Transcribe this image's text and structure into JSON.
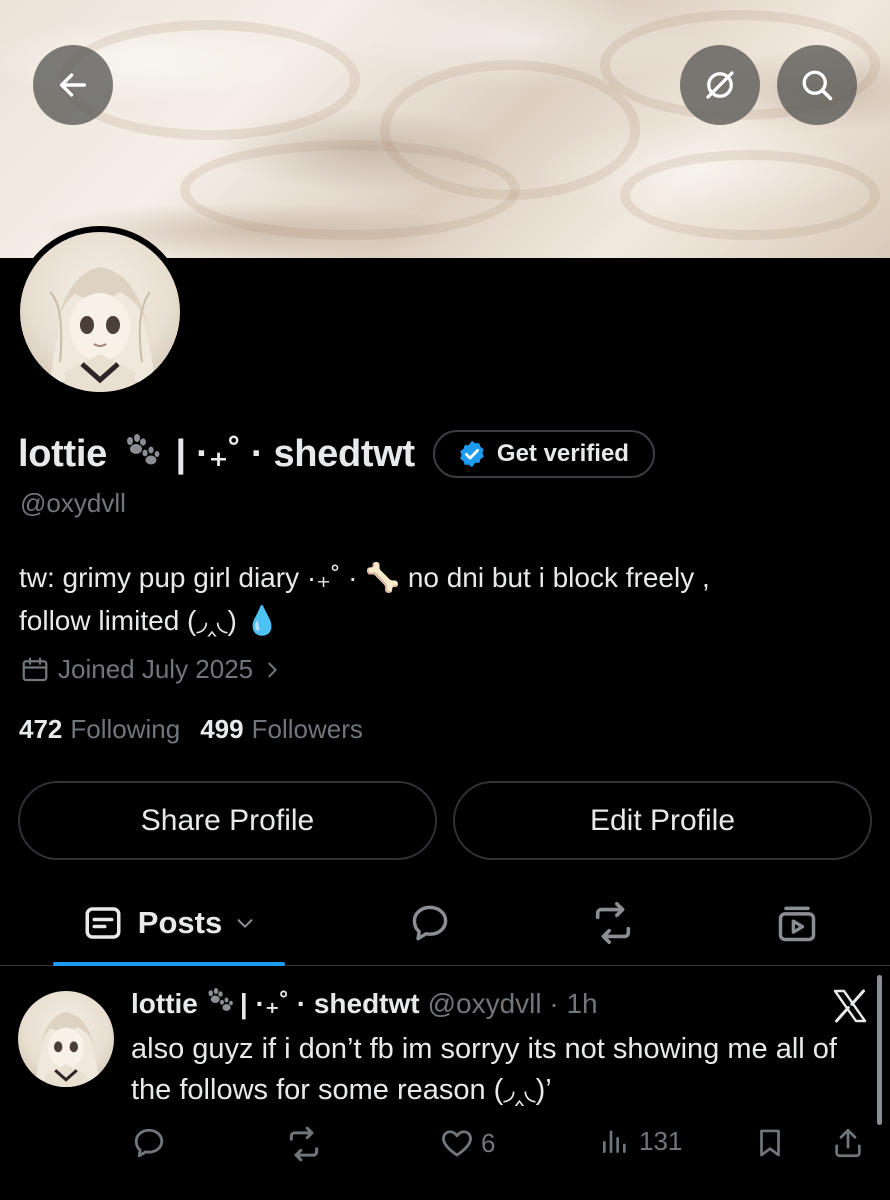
{
  "header": {
    "back_icon": "arrow-left-icon",
    "grok_icon": "grok-icon",
    "search_icon": "search-icon"
  },
  "profile": {
    "display_name_prefix": "lottie",
    "display_name_suffix": "| ·₊˚ · shedtwt",
    "get_verified_label": "Get verified",
    "handle": "@oxydvll",
    "bio_line1": "tw: grimy pup girl diary ·₊˚ · 🦴 no dni but i block freely ,",
    "bio_line2": "follow limited (◞‸◟) 💧",
    "joined": "Joined July 2025",
    "following_count": "472",
    "following_label": "Following",
    "followers_count": "499",
    "followers_label": "Followers",
    "accent_color": "#1d9bf0"
  },
  "buttons": {
    "share": "Share Profile",
    "edit": "Edit Profile"
  },
  "tabs": {
    "posts_label": "Posts",
    "replies_icon": "chat-bubble-icon",
    "reposts_icon": "repost-icon",
    "media_icon": "video-stack-icon"
  },
  "post": {
    "name_prefix": "lottie",
    "name_suffix": "| ·₊˚ · shedtwt",
    "handle_time": "@oxydvll · 1h",
    "text": "also guyz if i don’t fb im sorryy its not showing me all of the follows for some reason (◞‸◟)’",
    "likes": "6",
    "views": "131"
  }
}
